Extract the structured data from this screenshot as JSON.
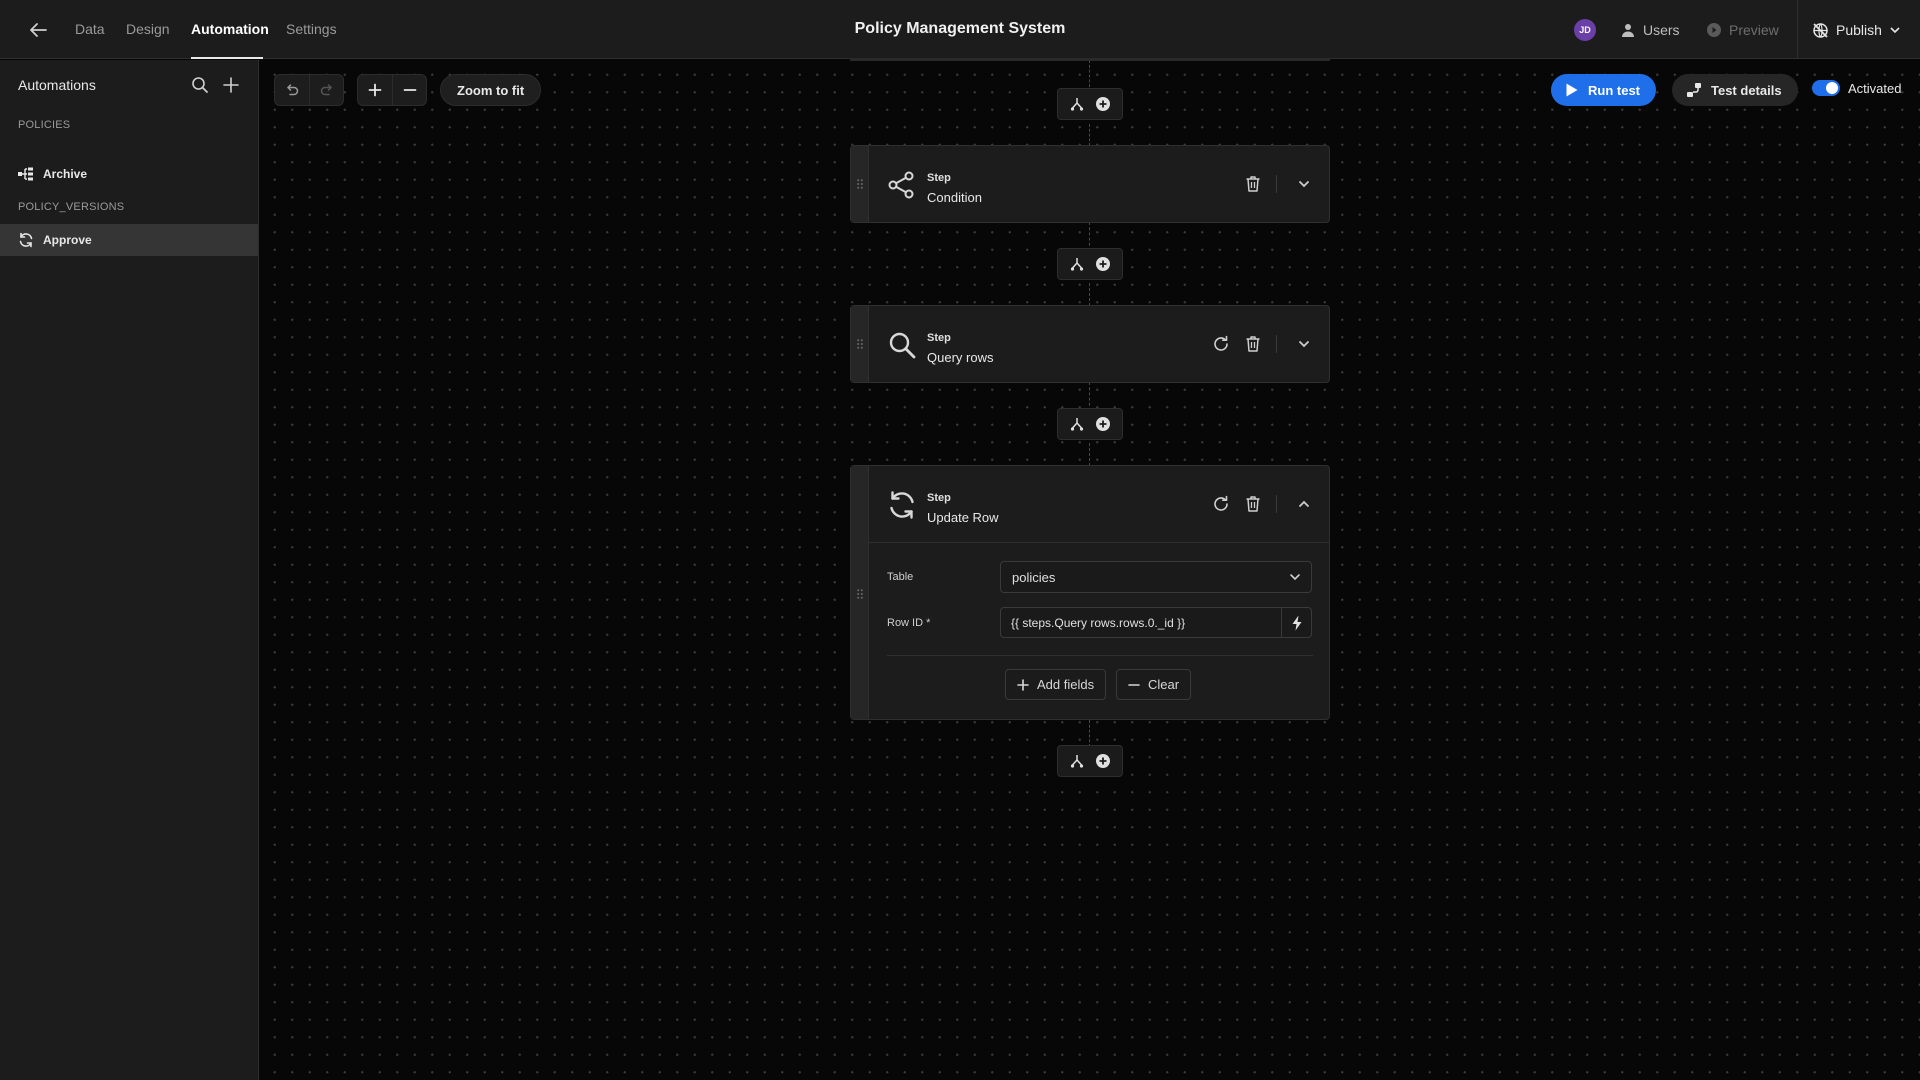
{
  "app": {
    "title": "Policy Management System"
  },
  "nav": {
    "tabs": [
      {
        "label": "Data",
        "active": false
      },
      {
        "label": "Design",
        "active": false
      },
      {
        "label": "Automation",
        "active": true
      },
      {
        "label": "Settings",
        "active": false
      }
    ]
  },
  "header": {
    "avatar_initials": "JD",
    "users_label": "Users",
    "preview_label": "Preview",
    "publish_label": "Publish"
  },
  "sidebar": {
    "title": "Automations",
    "sections": [
      {
        "label": "POLICIES",
        "items": [
          {
            "label": "Archive",
            "icon": "branch-icon",
            "selected": false
          }
        ]
      },
      {
        "label": "POLICY_VERSIONS",
        "items": [
          {
            "label": "Approve",
            "icon": "sync-icon",
            "selected": true
          }
        ]
      }
    ]
  },
  "toolbar": {
    "zoom_to_fit": "Zoom to fit",
    "run_test": "Run test",
    "test_details": "Test details",
    "activated_label": "Activated",
    "activated": true
  },
  "steps": [
    {
      "kicker": "Step",
      "name": "Condition",
      "icon": "share-icon",
      "expanded": false
    },
    {
      "kicker": "Step",
      "name": "Query rows",
      "icon": "search-icon",
      "expanded": false
    },
    {
      "kicker": "Step",
      "name": "Update Row",
      "icon": "sync-icon",
      "expanded": true,
      "fields": {
        "table_label": "Table",
        "table_value": "policies",
        "row_id_label": "Row ID *",
        "row_id_value": "{{ steps.Query rows.rows.0._id }}"
      },
      "add_fields_label": "Add fields",
      "clear_label": "Clear"
    }
  ],
  "colors": {
    "accent": "#1f6feb",
    "avatar": "#6b3fa8",
    "canvas_bg": "#070707",
    "panel_bg": "#1c1c1c"
  }
}
